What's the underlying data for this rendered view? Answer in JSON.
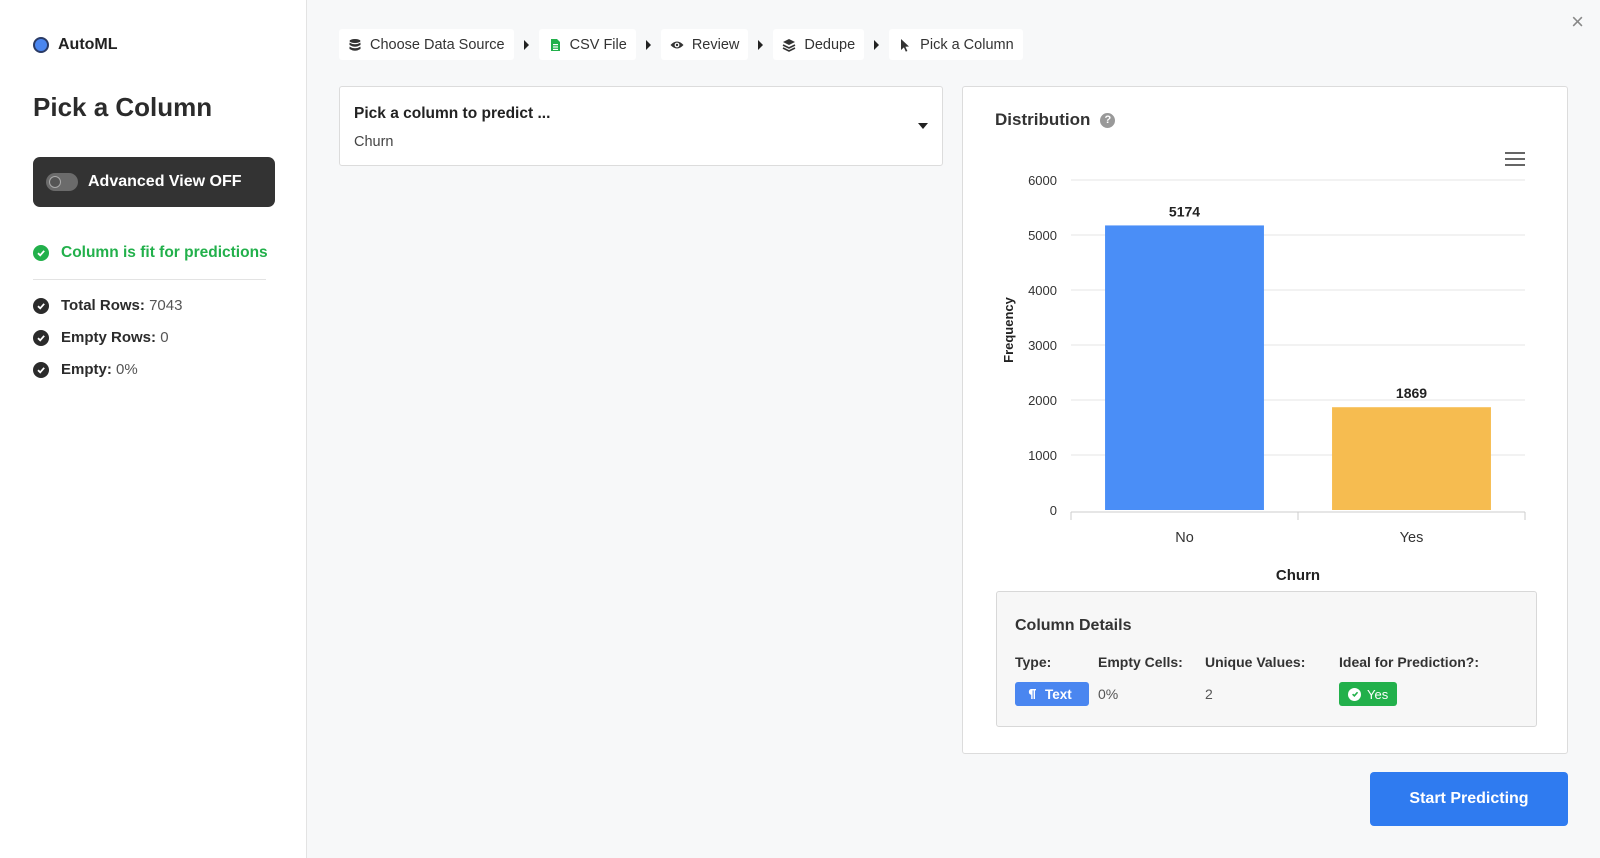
{
  "app": {
    "name": "AutoML"
  },
  "sidebar": {
    "title": "Pick a Column",
    "advanced_toggle": "Advanced View OFF",
    "fit_message": "Column is fit for predictions",
    "stats": [
      {
        "label": "Total Rows:",
        "value": "7043"
      },
      {
        "label": "Empty Rows:",
        "value": "0"
      },
      {
        "label": "Empty:",
        "value": "0%"
      }
    ]
  },
  "breadcrumbs": [
    {
      "label": "Choose Data Source",
      "icon": "database-icon"
    },
    {
      "label": "CSV File",
      "icon": "csv-file-icon"
    },
    {
      "label": "Review",
      "icon": "eye-icon"
    },
    {
      "label": "Dedupe",
      "icon": "layers-icon"
    },
    {
      "label": "Pick a Column",
      "icon": "cursor-icon"
    }
  ],
  "picker": {
    "label": "Pick a column to predict ...",
    "value": "Churn"
  },
  "distribution": {
    "title": "Distribution"
  },
  "chart_data": {
    "type": "bar",
    "categories": [
      "No",
      "Yes"
    ],
    "values": [
      5174,
      1869
    ],
    "colors": [
      "#4a8ef7",
      "#f6bc50"
    ],
    "xlabel": "Churn",
    "ylabel": "Frequency",
    "ylim": [
      0,
      6000
    ],
    "yticks": [
      0,
      1000,
      2000,
      3000,
      4000,
      5000,
      6000
    ],
    "data_labels": true,
    "grid": true
  },
  "column_details": {
    "title": "Column Details",
    "type_label": "Type:",
    "type_value": "Text",
    "empty_label": "Empty Cells:",
    "empty_value": "0%",
    "unique_label": "Unique Values:",
    "unique_value": "2",
    "ideal_label": "Ideal for Prediction?:",
    "ideal_value": "Yes"
  },
  "actions": {
    "start": "Start Predicting",
    "close": "×"
  }
}
